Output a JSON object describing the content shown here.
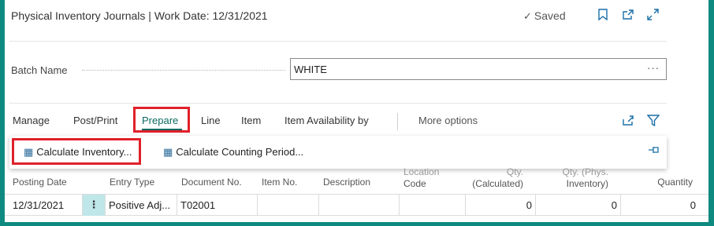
{
  "header": {
    "title": "Physical Inventory Journals | Work Date: 12/31/2021",
    "saved": "Saved",
    "icons": [
      "check-icon",
      "bookmark-icon",
      "open-new-window-icon",
      "expand-icon"
    ]
  },
  "batch": {
    "label": "Batch Name",
    "value": "WHITE",
    "more": "···"
  },
  "menu": {
    "manage": "Manage",
    "post_print": "Post/Print",
    "prepare": "Prepare",
    "line": "Line",
    "item": "Item",
    "item_availability": "Item Availability by",
    "more_options": "More options"
  },
  "actions": {
    "calc_inventory": "Calculate Inventory...",
    "calc_counting": "Calculate Counting Period..."
  },
  "grid": {
    "headers": {
      "posting_date": "Posting Date",
      "entry_type": "Entry Type",
      "document_no": "Document No.",
      "item_no": "Item No.",
      "description": "Description",
      "location_1": "Location",
      "location_2": "Code",
      "qty_calc_1": "Qty.",
      "qty_calc_2": "(Calculated)",
      "qty_phys_1": "Qty. (Phys.",
      "qty_phys_2": "Inventory)",
      "quantity": "Quantity"
    },
    "rows": [
      {
        "posting_date": "12/31/2021",
        "row_menu": "⋮",
        "entry_type": "Positive Adj...",
        "document_no": "T02001",
        "item_no": "",
        "description": "",
        "location": "",
        "qty_calculated": "0",
        "qty_phys": "0",
        "quantity": "0"
      }
    ]
  },
  "colors": {
    "background": "#0f8a80",
    "accent": "#0b6a62",
    "highlight_box": "#e0202a",
    "icon_blue": "#1a6fa8"
  }
}
